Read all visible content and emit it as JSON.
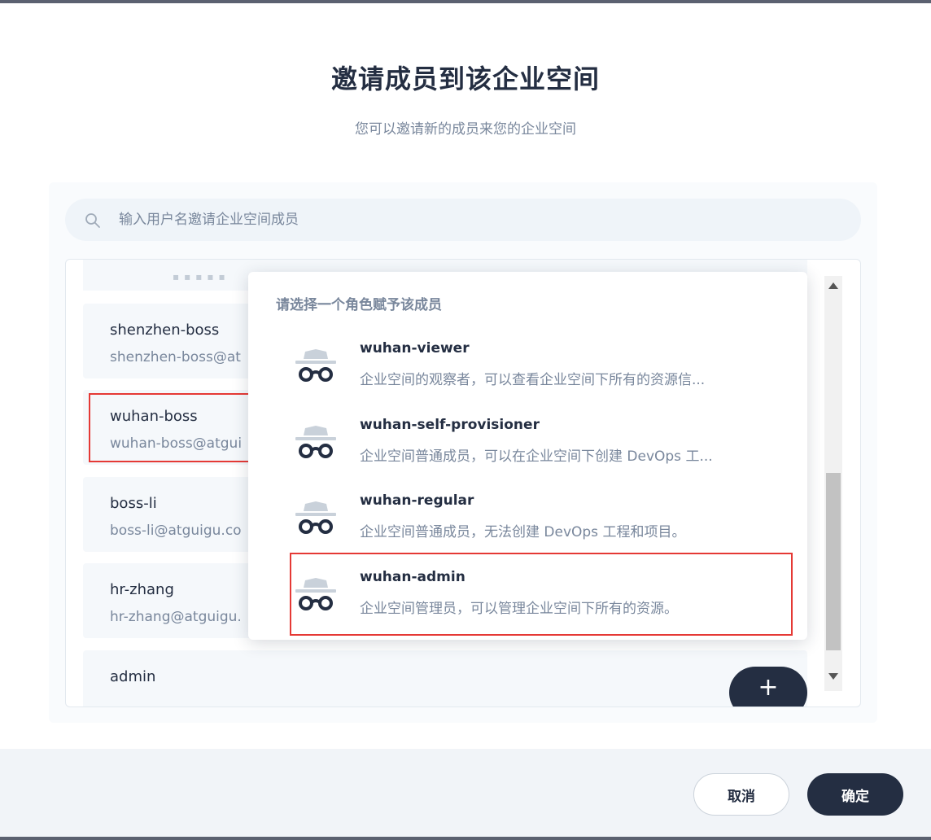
{
  "dialog": {
    "title": "邀请成员到该企业空间",
    "subtitle": "您可以邀请新的成员来您的企业空间"
  },
  "search": {
    "placeholder": "输入用户名邀请企业空间成员",
    "icon": "search-icon"
  },
  "users": [
    {
      "name": "shenzhen-boss",
      "email": "shenzhen-boss@at"
    },
    {
      "name": "wuhan-boss",
      "email": "wuhan-boss@atgui"
    },
    {
      "name": "boss-li",
      "email": "boss-li@atguigu.co"
    },
    {
      "name": "hr-zhang",
      "email": "hr-zhang@atguigu."
    },
    {
      "name": "admin",
      "email": ""
    }
  ],
  "add_button": {
    "label": "+"
  },
  "role_dropdown": {
    "title": "请选择一个角色赋予该成员",
    "icon": "incognito-icon",
    "roles": [
      {
        "name": "wuhan-viewer",
        "description": "企业空间的观察者，可以查看企业空间下所有的资源信..."
      },
      {
        "name": "wuhan-self-provisioner",
        "description": "企业空间普通成员，可以在企业空间下创建 DevOps 工..."
      },
      {
        "name": "wuhan-regular",
        "description": "企业空间普通成员，无法创建 DevOps 工程和项目。"
      },
      {
        "name": "wuhan-admin",
        "description": "企业空间管理员，可以管理企业空间下所有的资源。"
      }
    ]
  },
  "footer": {
    "cancel_label": "取消",
    "confirm_label": "确定"
  },
  "colors": {
    "primary_dark": "#242e42",
    "muted_text": "#79879c",
    "highlight_red": "#e53935"
  }
}
